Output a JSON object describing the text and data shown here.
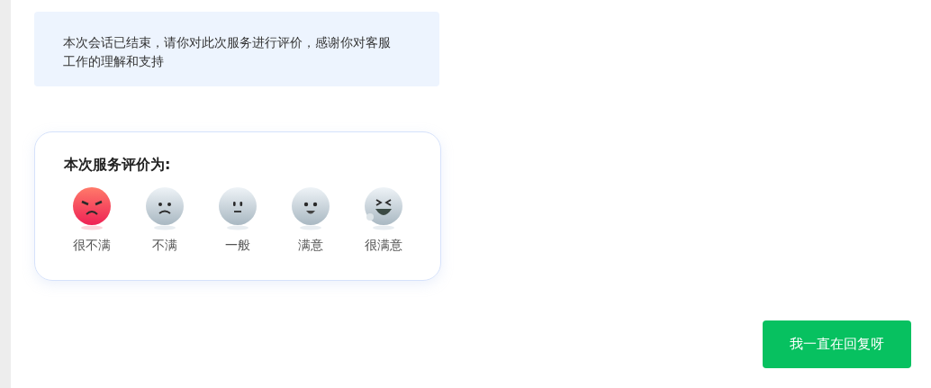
{
  "notice": {
    "text": "本次会话已结束，请你对此次服务进行评价，感谢你对客服工作的理解和支持"
  },
  "rating": {
    "title": "本次服务评价为:",
    "options": [
      {
        "kind": "angry",
        "label": "很不满",
        "selected": true
      },
      {
        "kind": "sad",
        "label": "不满",
        "selected": false
      },
      {
        "kind": "neutral",
        "label": "一般",
        "selected": false
      },
      {
        "kind": "smile",
        "label": "满意",
        "selected": false
      },
      {
        "kind": "laugh",
        "label": "很满意",
        "selected": false
      }
    ]
  },
  "reply_button": {
    "label": "我一直在回复呀"
  }
}
